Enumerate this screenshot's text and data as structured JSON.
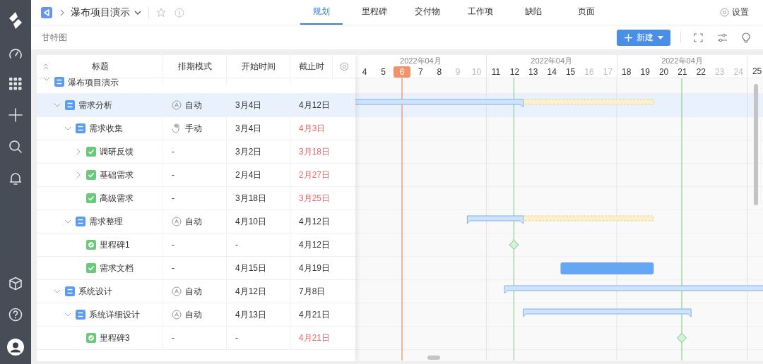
{
  "project": {
    "title": "瀑布项目演示"
  },
  "tabs": [
    {
      "label": "规划",
      "selected": true
    },
    {
      "label": "里程碑",
      "selected": false
    },
    {
      "label": "交付物",
      "selected": false
    },
    {
      "label": "工作项",
      "selected": false
    },
    {
      "label": "缺陷",
      "selected": false
    },
    {
      "label": "页面",
      "selected": false
    }
  ],
  "settings_link": "设置",
  "view_title": "甘特图",
  "new_button": "新建",
  "table": {
    "columns": [
      "标题",
      "排期模式",
      "开始时间",
      "截止时"
    ],
    "rows": [
      {
        "title": "瀑布项目演示",
        "kind": "summary",
        "expanded": true,
        "selected": false,
        "children": [
          {
            "title": "需求分析",
            "kind": "summary",
            "expanded": true,
            "selected": true,
            "mode": {
              "kind": "auto",
              "text": "自动"
            },
            "start": "3月4日",
            "end": "4月12日",
            "overdue": false,
            "slack": true,
            "children": [
              {
                "title": "需求收集",
                "kind": "summary",
                "expanded": true,
                "selected": false,
                "mode": {
                  "kind": "manual",
                  "text": "手动"
                },
                "start": "3月4日",
                "end": "4月3日",
                "overdue": true,
                "children": [
                  {
                    "title": "调研反馈",
                    "kind": "task",
                    "expanded": false,
                    "selected": false,
                    "mode": {
                      "text": "-"
                    },
                    "start": "3月2日",
                    "end": "3月18日",
                    "overdue": true
                  },
                  {
                    "title": "基础需求",
                    "kind": "task",
                    "expanded": false,
                    "selected": false,
                    "mode": {
                      "text": "-"
                    },
                    "start": "2月4日",
                    "end": "2月27日",
                    "overdue": true
                  },
                  {
                    "title": "高级需求",
                    "kind": "task",
                    "selected": false,
                    "mode": {
                      "text": "-"
                    },
                    "start": "3月18日",
                    "end": "3月25日",
                    "overdue": true
                  }
                ]
              },
              {
                "title": "需求整理",
                "kind": "summary",
                "expanded": true,
                "selected": false,
                "mode": {
                  "kind": "auto",
                  "text": "自动"
                },
                "start": "4月10日",
                "end": "4月12日",
                "overdue": false,
                "slack": true,
                "children": [
                  {
                    "title": "里程碑1",
                    "kind": "milestone",
                    "selected": false,
                    "mode": {
                      "text": "-"
                    },
                    "start": "-",
                    "end": "4月12日",
                    "overdue": false
                  },
                  {
                    "title": "需求文档",
                    "kind": "task",
                    "selected": false,
                    "mode": {
                      "text": "-"
                    },
                    "start": "4月15日",
                    "end": "4月19日",
                    "overdue": false
                  }
                ]
              }
            ]
          },
          {
            "title": "系统设计",
            "kind": "summary",
            "expanded": true,
            "selected": false,
            "mode": {
              "kind": "auto",
              "text": "自动"
            },
            "start": "4月12日",
            "end": "7月8日",
            "overdue": false,
            "children": [
              {
                "title": "系统详细设计",
                "kind": "summary",
                "expanded": true,
                "selected": false,
                "mode": {
                  "kind": "auto",
                  "text": "自动"
                },
                "start": "4月13日",
                "end": "4月21日",
                "overdue": false,
                "children": [
                  {
                    "title": "里程碑3",
                    "kind": "milestone",
                    "selected": false,
                    "mode": {
                      "text": "-"
                    },
                    "start": "-",
                    "end": "4月21日",
                    "overdue": true
                  }
                ]
              }
            ]
          }
        ]
      }
    ]
  },
  "gantt": {
    "weeks": [
      {
        "month": "2022年04月",
        "days": [
          {
            "label": "4",
            "weekend": false,
            "today": false
          },
          {
            "label": "5",
            "weekend": false,
            "today": false
          },
          {
            "label": "6",
            "weekend": false,
            "today": true
          },
          {
            "label": "7",
            "weekend": false,
            "today": false
          },
          {
            "label": "8",
            "weekend": false,
            "today": false
          },
          {
            "label": "9",
            "weekend": true,
            "today": false
          },
          {
            "label": "10",
            "weekend": true,
            "today": false
          }
        ]
      },
      {
        "month": "2022年04月",
        "days": [
          {
            "label": "11",
            "weekend": false,
            "today": false
          },
          {
            "label": "12",
            "weekend": false,
            "today": false
          },
          {
            "label": "13",
            "weekend": false,
            "today": false
          },
          {
            "label": "14",
            "weekend": false,
            "today": false
          },
          {
            "label": "15",
            "weekend": false,
            "today": false
          },
          {
            "label": "16",
            "weekend": true,
            "today": false
          },
          {
            "label": "17",
            "weekend": true,
            "today": false
          }
        ]
      },
      {
        "month": "2022年04月",
        "days": [
          {
            "label": "18",
            "weekend": false,
            "today": false
          },
          {
            "label": "19",
            "weekend": false,
            "today": false
          },
          {
            "label": "20",
            "weekend": false,
            "today": false
          },
          {
            "label": "21",
            "weekend": false,
            "today": false
          },
          {
            "label": "22",
            "weekend": false,
            "today": false
          },
          {
            "label": "23",
            "weekend": true,
            "today": false
          },
          {
            "label": "24",
            "weekend": true,
            "today": false
          }
        ]
      },
      {
        "days": [
          {
            "label": "25",
            "weekend": false,
            "today": false
          }
        ]
      }
    ]
  }
}
